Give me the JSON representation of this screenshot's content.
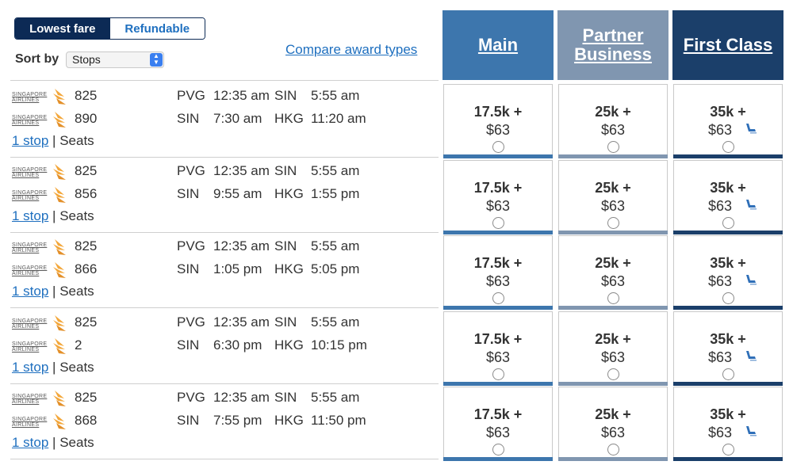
{
  "filters": {
    "fare_type": [
      "Lowest fare",
      "Refundable"
    ],
    "sort_label": "Sort by",
    "sort_value": "Stops",
    "compare_link": "Compare award types"
  },
  "columns": [
    {
      "label_line1": "Main",
      "label_line2": "",
      "color": "#3d76ad"
    },
    {
      "label_line1": "Partner",
      "label_line2": "Business",
      "color": "#8096b0"
    },
    {
      "label_line1": "First Class",
      "label_line2": "",
      "color": "#1b3f6a"
    }
  ],
  "airline_logo_text": "SINGAPORE AIRLINES",
  "rows": [
    {
      "segments": [
        {
          "flight": "825",
          "from": "PVG",
          "dep": "12:35 am",
          "to": "SIN",
          "arr": "5:55 am"
        },
        {
          "flight": "890",
          "from": "SIN",
          "dep": "7:30 am",
          "to": "HKG",
          "arr": "11:20 am"
        }
      ],
      "stops": "1 stop",
      "sep": "|",
      "seats": "Seats",
      "fares": [
        {
          "miles": "17.5k +",
          "tax": "$63"
        },
        {
          "miles": "25k +",
          "tax": "$63"
        },
        {
          "miles": "35k +",
          "tax": "$63"
        }
      ]
    },
    {
      "segments": [
        {
          "flight": "825",
          "from": "PVG",
          "dep": "12:35 am",
          "to": "SIN",
          "arr": "5:55 am"
        },
        {
          "flight": "856",
          "from": "SIN",
          "dep": "9:55 am",
          "to": "HKG",
          "arr": "1:55 pm"
        }
      ],
      "stops": "1 stop",
      "sep": "|",
      "seats": "Seats",
      "fares": [
        {
          "miles": "17.5k +",
          "tax": "$63"
        },
        {
          "miles": "25k +",
          "tax": "$63"
        },
        {
          "miles": "35k +",
          "tax": "$63"
        }
      ]
    },
    {
      "segments": [
        {
          "flight": "825",
          "from": "PVG",
          "dep": "12:35 am",
          "to": "SIN",
          "arr": "5:55 am"
        },
        {
          "flight": "866",
          "from": "SIN",
          "dep": "1:05 pm",
          "to": "HKG",
          "arr": "5:05 pm"
        }
      ],
      "stops": "1 stop",
      "sep": "|",
      "seats": "Seats",
      "fares": [
        {
          "miles": "17.5k +",
          "tax": "$63"
        },
        {
          "miles": "25k +",
          "tax": "$63"
        },
        {
          "miles": "35k +",
          "tax": "$63"
        }
      ]
    },
    {
      "segments": [
        {
          "flight": "825",
          "from": "PVG",
          "dep": "12:35 am",
          "to": "SIN",
          "arr": "5:55 am"
        },
        {
          "flight": "2",
          "from": "SIN",
          "dep": "6:30 pm",
          "to": "HKG",
          "arr": "10:15 pm"
        }
      ],
      "stops": "1 stop",
      "sep": "|",
      "seats": "Seats",
      "fares": [
        {
          "miles": "17.5k +",
          "tax": "$63"
        },
        {
          "miles": "25k +",
          "tax": "$63"
        },
        {
          "miles": "35k +",
          "tax": "$63"
        }
      ]
    },
    {
      "segments": [
        {
          "flight": "825",
          "from": "PVG",
          "dep": "12:35 am",
          "to": "SIN",
          "arr": "5:55 am"
        },
        {
          "flight": "868",
          "from": "SIN",
          "dep": "7:55 pm",
          "to": "HKG",
          "arr": "11:50 pm"
        }
      ],
      "stops": "1 stop",
      "sep": "|",
      "seats": "Seats",
      "fares": [
        {
          "miles": "17.5k +",
          "tax": "$63"
        },
        {
          "miles": "25k +",
          "tax": "$63"
        },
        {
          "miles": "35k +",
          "tax": "$63"
        }
      ]
    }
  ],
  "first_class_icon": "seat-icon",
  "accent_color": "#1e6fbf"
}
